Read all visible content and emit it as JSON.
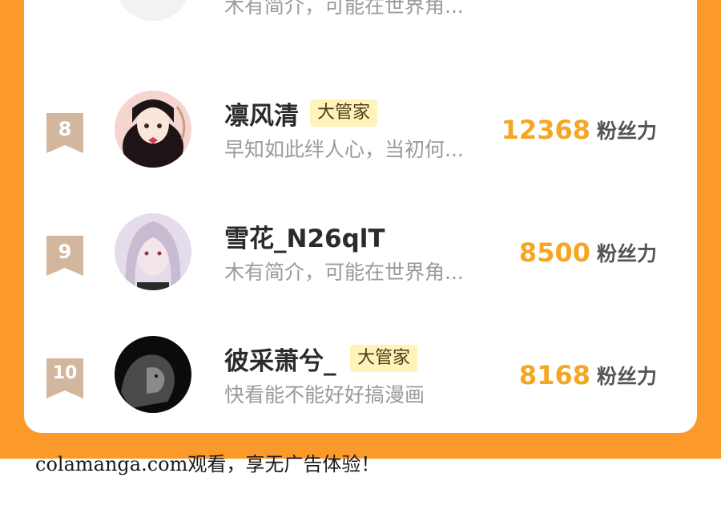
{
  "colors": {
    "orange_background": "#fb9a2a",
    "fans_number": "#f5a623",
    "tag_background": "#fff3b8",
    "rank_badge": "#d2b69e"
  },
  "partial_row": {
    "bio": "木有简介，可能在世界角..."
  },
  "rows": [
    {
      "rank": "8",
      "avatar_icon": "anime-girl-avatar-icon",
      "name": "凛风清",
      "tag": "大管家",
      "bio": "早知如此绊人心，当初何...",
      "fans": "12368",
      "fans_label": "粉丝力"
    },
    {
      "rank": "9",
      "avatar_icon": "silver-hair-man-avatar-icon",
      "name": "雪花_N26qlT",
      "tag": "",
      "bio": "木有简介，可能在世界角...",
      "fans": "8500",
      "fans_label": "粉丝力"
    },
    {
      "rank": "10",
      "avatar_icon": "lion-avatar-icon",
      "name": "彼采萧兮_",
      "tag": "大管家",
      "bio": "快看能不能好好搞漫画",
      "fans": "8168",
      "fans_label": "粉丝力"
    }
  ],
  "watermark": "colamanga.com观看，享无广告体验！"
}
